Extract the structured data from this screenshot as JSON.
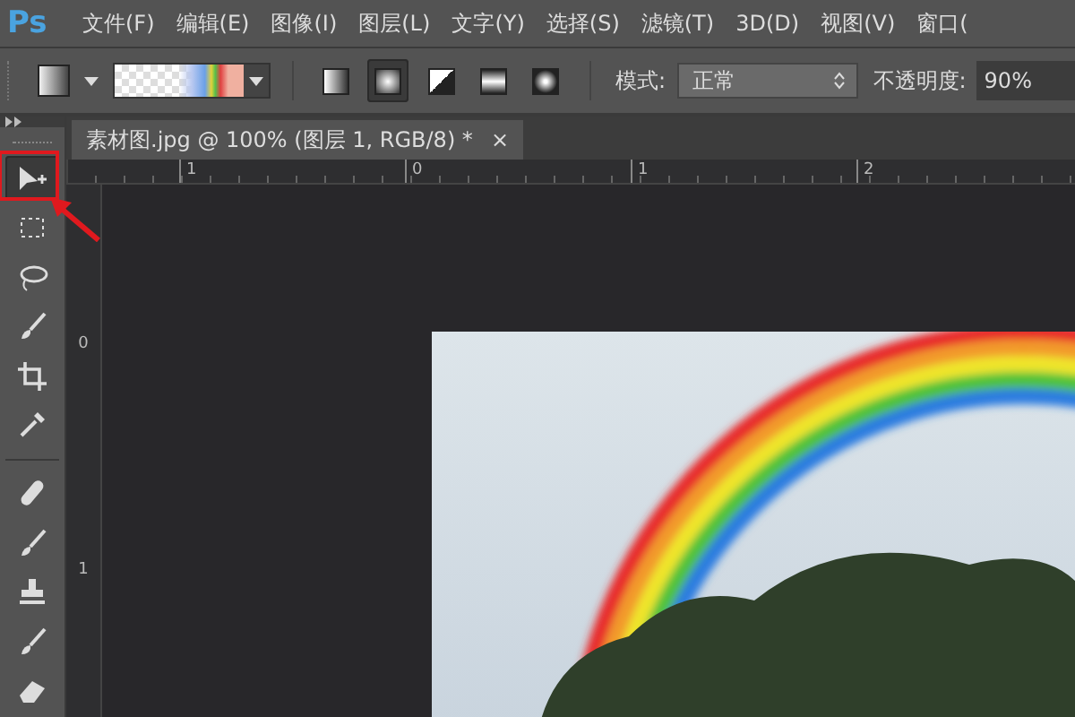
{
  "app_logo": "Ps",
  "menu": [
    "文件(F)",
    "编辑(E)",
    "图像(I)",
    "图层(L)",
    "文字(Y)",
    "选择(S)",
    "滤镜(T)",
    "3D(D)",
    "视图(V)",
    "窗口("
  ],
  "options_bar": {
    "gradient_types": [
      {
        "kind": "linear",
        "selected": false
      },
      {
        "kind": "radial",
        "selected": true
      },
      {
        "kind": "angle",
        "selected": false
      },
      {
        "kind": "reflected",
        "selected": false
      },
      {
        "kind": "diamond",
        "selected": false
      }
    ],
    "mode_label": "模式:",
    "mode_value": "正常",
    "opacity_label": "不透明度:",
    "opacity_value": "90%"
  },
  "document_tab": {
    "title": "素材图.jpg @ 100% (图层 1, RGB/8) *",
    "close": "×"
  },
  "horizontal_ruler": [
    "1",
    "0",
    "1",
    "2"
  ],
  "vertical_ruler": [
    "0",
    "1"
  ],
  "tools": [
    {
      "kind": "move",
      "selected": true,
      "highlighted": true
    },
    {
      "kind": "marquee",
      "selected": false,
      "highlighted": false
    },
    {
      "kind": "lasso",
      "selected": false,
      "highlighted": false
    },
    {
      "kind": "quick-select",
      "selected": false,
      "highlighted": false
    },
    {
      "kind": "crop",
      "selected": false,
      "highlighted": false
    },
    {
      "kind": "eyedropper",
      "selected": false,
      "highlighted": false
    },
    {
      "kind": "heal",
      "selected": false,
      "highlighted": false
    },
    {
      "kind": "brush",
      "selected": false,
      "highlighted": false
    },
    {
      "kind": "stamp",
      "selected": false,
      "highlighted": false
    },
    {
      "kind": "history-brush",
      "selected": false,
      "highlighted": false
    },
    {
      "kind": "eraser",
      "selected": false,
      "highlighted": false
    }
  ]
}
